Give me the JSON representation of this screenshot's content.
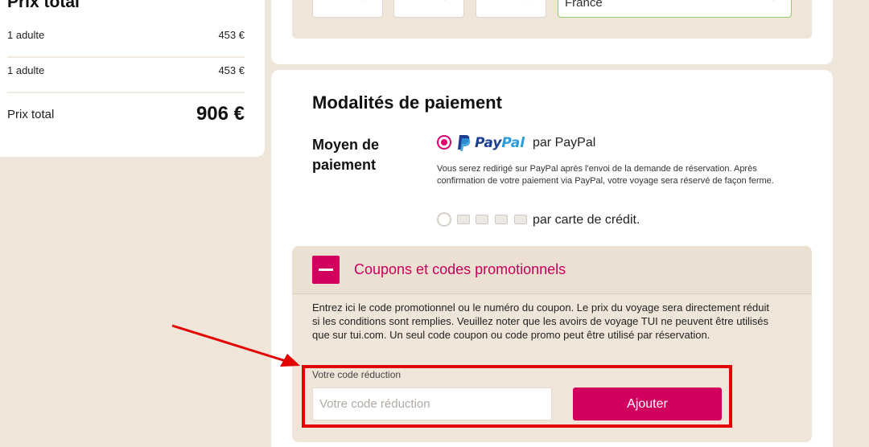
{
  "summary": {
    "title": "Prix total",
    "rows": [
      {
        "label": "1 adulte",
        "price": "453 €"
      },
      {
        "label": "1 adulte",
        "price": "453 €"
      }
    ],
    "total_label": "Prix total",
    "total_value": "906 €"
  },
  "address": {
    "country_value": "France"
  },
  "payment": {
    "title": "Modalités de paiement",
    "method_label": "Moyen de paiement",
    "paypal": {
      "selected": true,
      "logo_text_1": "Pay",
      "logo_text_2": "Pal",
      "label": "par PayPal",
      "note": "Vous serez redirigé sur PayPal après l'envoi de la demande de réservation. Après confirmation de votre paiement via PayPal, votre voyage sera réservé de façon ferme."
    },
    "credit_card": {
      "selected": false,
      "label": "par carte de crédit."
    }
  },
  "coupon": {
    "expanded": true,
    "title": "Coupons et codes promotionnels",
    "description": "Entrez ici le code promotionnel ou le numéro du coupon. Le prix du voyage sera directement réduit si les conditions sont remplies. Veuillez noter que les avoirs de voyage TUI ne peuvent être utilisés que sur tui.com. Un seul code coupon ou code promo peut être utilisé par réservation.",
    "field_label": "Votre code réduction",
    "input_placeholder": "Votre code réduction",
    "input_value": "",
    "button_label": "Ajouter"
  },
  "colors": {
    "accent": "#d1005f",
    "background": "#efe5d9",
    "annotation": "#e20000",
    "valid_border": "#8ccf62"
  },
  "icons": [
    "chevron-down-icon",
    "paypal-logo-icon",
    "minus-icon",
    "credit-card-icon",
    "red-arrow-icon"
  ]
}
